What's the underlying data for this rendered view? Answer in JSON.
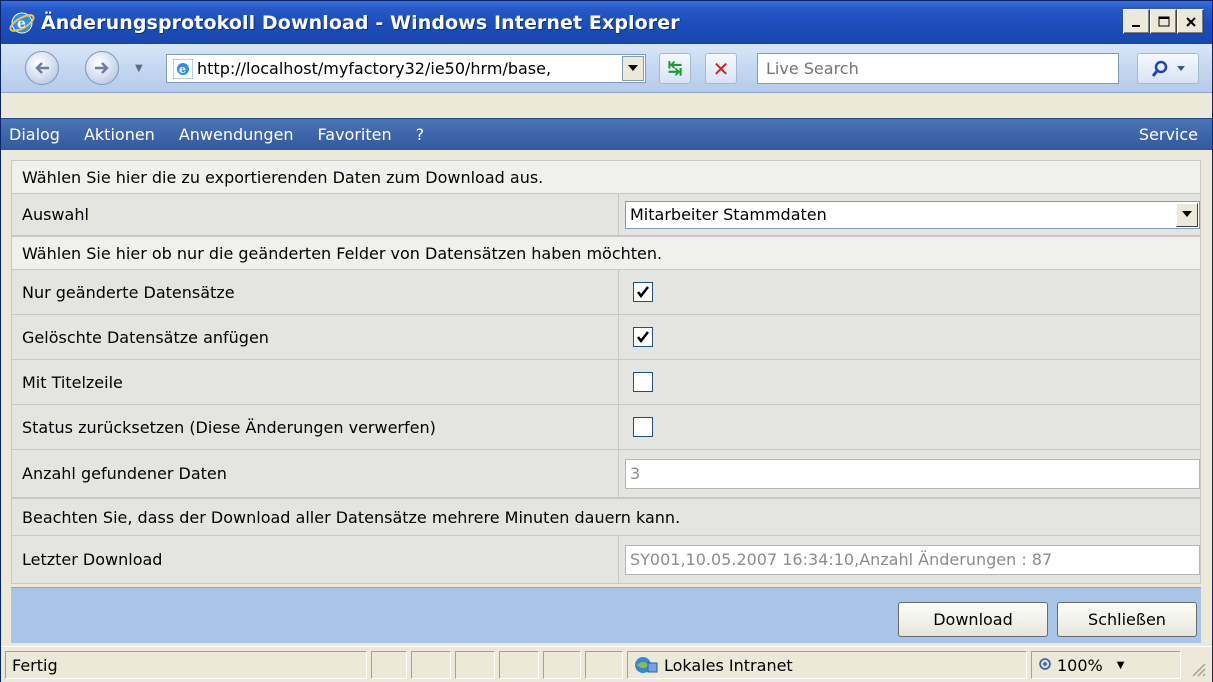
{
  "window": {
    "title": "Änderungsprotokoll Download - Windows Internet Explorer"
  },
  "browser": {
    "url": "http://localhost/myfactory32/ie50/hrm/base,",
    "search_placeholder": "Live Search"
  },
  "menu": {
    "items": [
      "Dialog",
      "Aktionen",
      "Anwendungen",
      "Favoriten",
      "?"
    ],
    "right": "Service"
  },
  "form": {
    "intro": "Wählen Sie hier die zu exportierenden Daten zum Download aus.",
    "auswahl_label": "Auswahl",
    "auswahl_value": "Mitarbeiter Stammdaten",
    "hint": "Wählen Sie hier ob nur die geänderten Felder von Datensätzen haben möchten.",
    "checkboxes": [
      {
        "label": "Nur geänderte Datensätze",
        "checked": true
      },
      {
        "label": "Gelöschte Datensätze anfügen",
        "checked": true
      },
      {
        "label": "Mit Titelzeile",
        "checked": false
      },
      {
        "label": "Status zurücksetzen (Diese Änderungen verwerfen)",
        "checked": false
      }
    ],
    "count_label": "Anzahl gefundener Daten",
    "count_value": "3",
    "warning": "Beachten Sie, dass der Download aller Datensätze mehrere Minuten dauern kann.",
    "last_label": "Letzter Download",
    "last_value": "SY001,10.05.2007 16:34:10,Anzahl Änderungen : 87"
  },
  "buttons": {
    "download": "Download",
    "close": "Schließen"
  },
  "status": {
    "text": "Fertig",
    "zone": "Lokales Intranet",
    "zoom": "100%"
  }
}
